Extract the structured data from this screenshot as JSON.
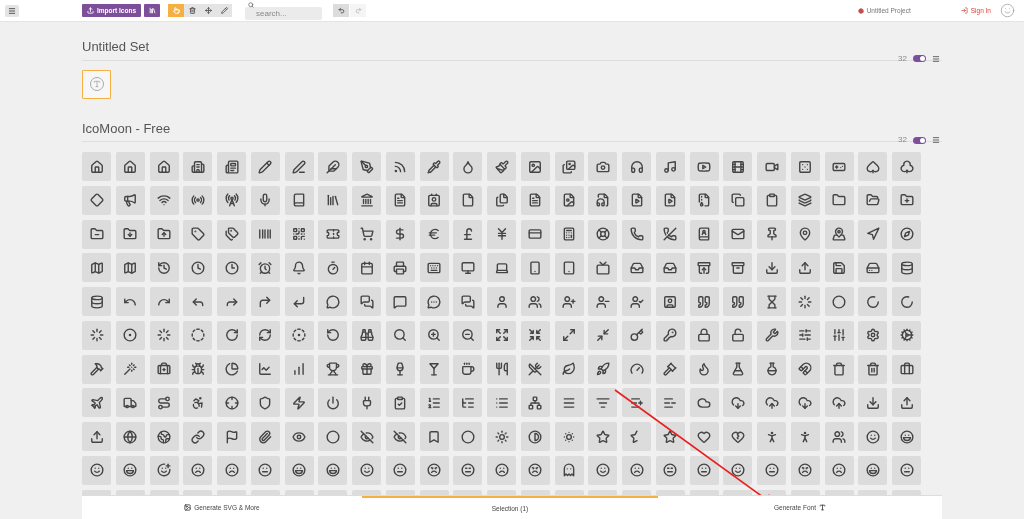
{
  "toolbar": {
    "import_label": "Import Icons",
    "tools": [
      {
        "selected": true
      },
      {
        "selected": false
      },
      {
        "selected": false
      },
      {
        "selected": false
      }
    ],
    "search": {
      "placeholder": "search..."
    },
    "history": [
      {
        "disabled": false
      },
      {
        "disabled": true
      }
    ]
  },
  "project": {
    "title": "Untitled Project"
  },
  "sign_in": "Sign In",
  "sets": [
    {
      "title": "Untitled Set",
      "size": "32",
      "on": true,
      "icons": [
        {
          "selected": true
        }
      ]
    },
    {
      "title": "IcoMoon - Free",
      "size": "32",
      "on": true
    }
  ],
  "footer": {
    "generate_svg": "Generate SVG & More",
    "selection": "Selection (1)",
    "generate_font": "Generate Font"
  }
}
